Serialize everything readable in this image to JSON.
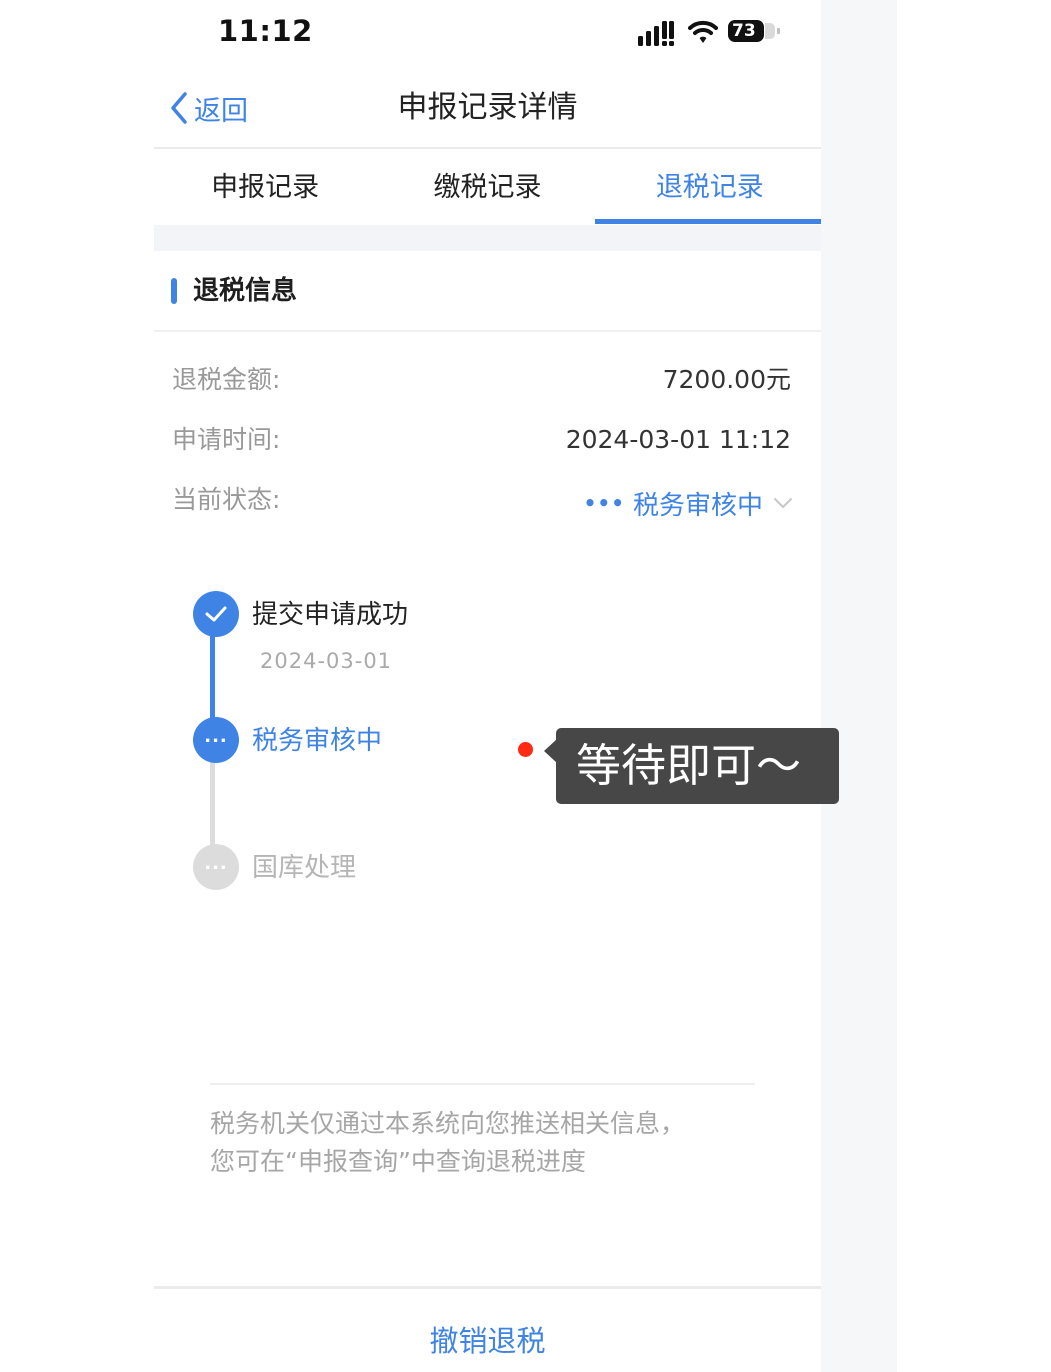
{
  "status_bar": {
    "time": "11:12",
    "battery": "73"
  },
  "nav": {
    "back_label": "返回",
    "title": "申报记录详情"
  },
  "tabs": [
    {
      "label": "申报记录",
      "active": false
    },
    {
      "label": "缴税记录",
      "active": false
    },
    {
      "label": "退税记录",
      "active": true
    }
  ],
  "section": {
    "title": "退税信息"
  },
  "info": {
    "amount_label": "退税金额:",
    "amount_value": "7200.00元",
    "time_label": "申请时间:",
    "time_value": "2024-03-01 11:12",
    "status_label": "当前状态:",
    "status_value": "税务审核中"
  },
  "timeline": [
    {
      "title": "提交申请成功",
      "date": "2024-03-01",
      "state": "done"
    },
    {
      "title": "税务审核中",
      "state": "current"
    },
    {
      "title": "国库处理",
      "state": "pending"
    }
  ],
  "note": {
    "line1": "税务机关仅通过本系统向您推送相关信息，",
    "line2": "您可在“申报查询”中查询退税进度"
  },
  "bottom": {
    "cancel_label": "撤销退税"
  },
  "annotation": {
    "text": "等待即可～"
  },
  "colors": {
    "accent": "#3f84e5",
    "annotation_bg": "#474747",
    "dot": "#ff2a13"
  }
}
